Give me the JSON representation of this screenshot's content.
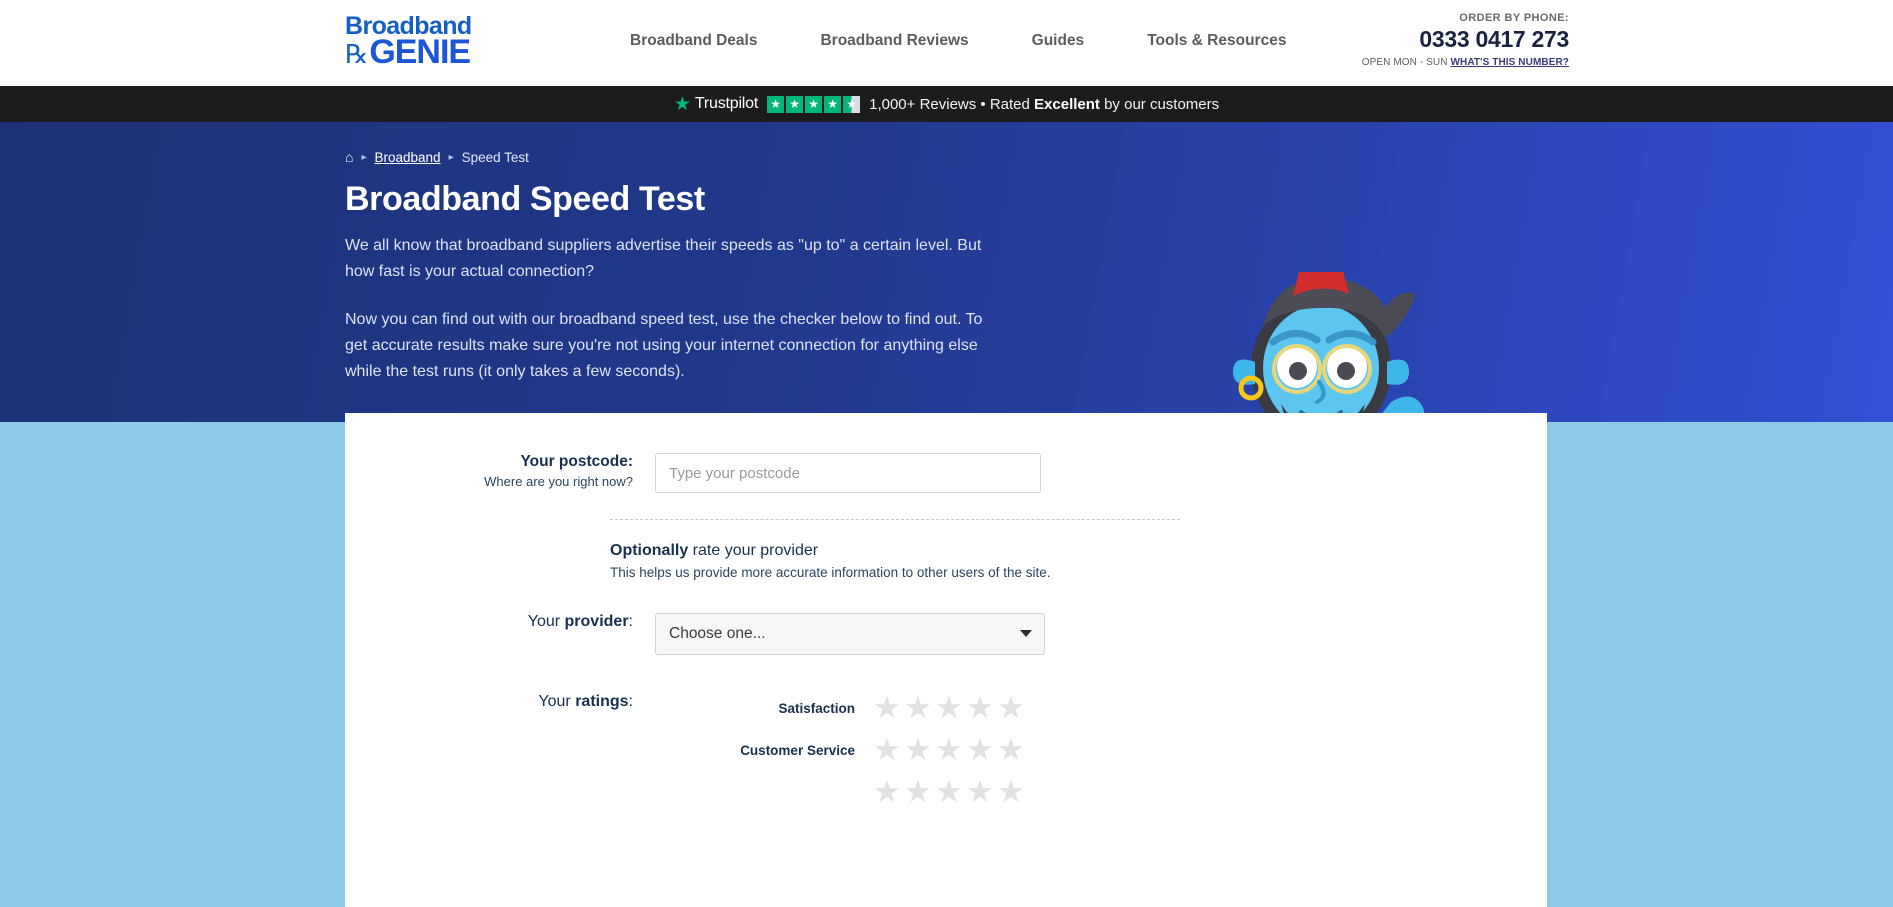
{
  "header": {
    "logo": {
      "line1": "Broadband",
      "line2": "GENIE",
      "swirl_icon": "swirl-icon"
    },
    "nav": [
      {
        "label": "Broadband Deals"
      },
      {
        "label": "Broadband Reviews"
      },
      {
        "label": "Guides"
      },
      {
        "label": "Tools & Resources"
      }
    ],
    "phone": {
      "label": "ORDER BY PHONE:",
      "number": "0333 0417 273",
      "hours": "OPEN MON - SUN",
      "link": "WHAT'S THIS NUMBER?"
    }
  },
  "trustpilot": {
    "brand": "Trustpilot",
    "star_icon": "trustpilot-star-icon",
    "rating_stars": 4.5,
    "total_stars": 5,
    "text_before": "1,000+ Reviews • Rated",
    "rating_word": "Excellent",
    "text_after": "by our customers",
    "green": "#00b67a",
    "bar_bg": "#1c1c1c"
  },
  "hero": {
    "breadcrumb": {
      "home_icon": "home-icon",
      "separator": "▸",
      "items": [
        {
          "label": "Broadband",
          "link": true
        },
        {
          "label": "Speed Test",
          "link": false
        }
      ]
    },
    "title": "Broadband Speed Test",
    "paragraph1": "We all know that broadband suppliers advertise their speeds as \"up to\" a certain level. But how fast is your actual connection?",
    "paragraph2": "Now you can find out with our broadband speed test, use the checker below to find out. To get accurate results make sure you're not using your internet connection for anything else while the test runs (it only takes a few seconds).",
    "mascot_icon": "genie-mascot-icon",
    "bg_from": "#1d3176",
    "bg_to": "#3450d6"
  },
  "band_color": "#8fcae8",
  "form": {
    "postcode": {
      "label": "Your postcode",
      "label_suffix": ":",
      "label_bold_part": "Your postcode",
      "sublabel": "Where are you right now?",
      "placeholder": "Type your postcode",
      "value": ""
    },
    "optional": {
      "title_bold": "Optionally",
      "title_rest": " rate your provider",
      "subtitle": "This helps us provide more accurate information to other users of the site."
    },
    "provider": {
      "label_prefix": "Your ",
      "label_bold": "provider",
      "label_suffix": ":",
      "selected": "Choose one...",
      "arrow_icon": "chevron-down-icon"
    },
    "ratings": {
      "label_prefix": "Your ",
      "label_bold": "ratings",
      "label_suffix": ":",
      "star_icon": "star-icon",
      "star_empty_color": "#e2e2e2",
      "max_stars": 5,
      "items": [
        {
          "name": "Satisfaction",
          "value": 0
        },
        {
          "name": "Customer Service",
          "value": 0
        },
        {
          "name": "",
          "value": 0
        }
      ]
    }
  }
}
